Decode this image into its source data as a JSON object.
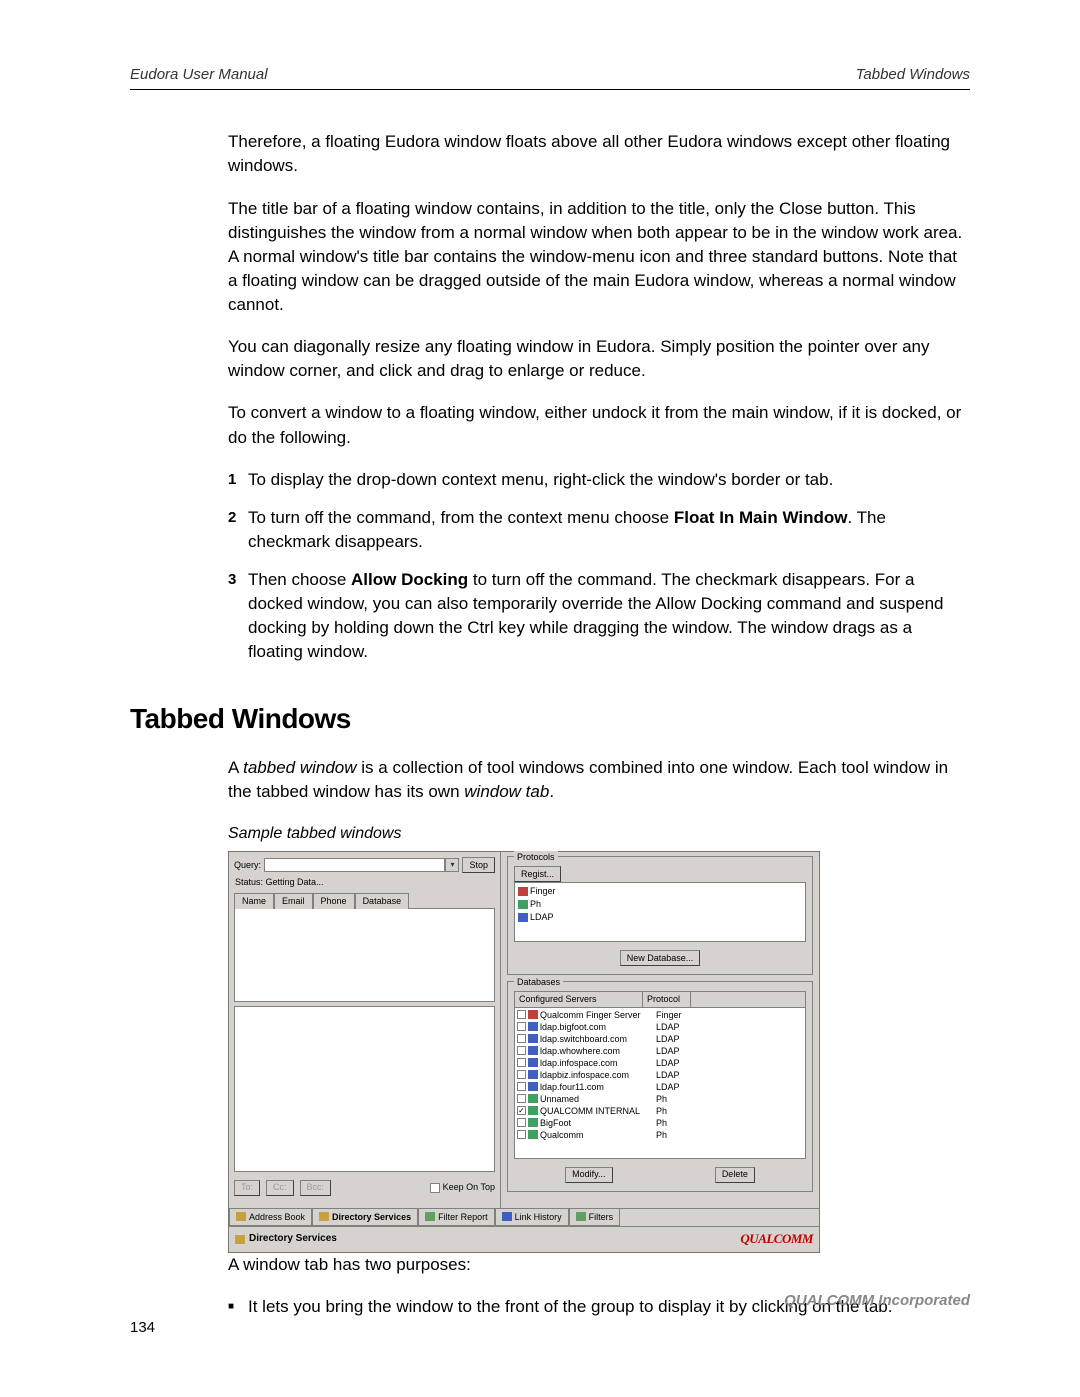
{
  "header": {
    "left": "Eudora User Manual",
    "right": "Tabbed Windows"
  },
  "para1": "Therefore, a floating Eudora window floats above all other Eudora windows except other floating windows.",
  "para2": "The title bar of a floating window contains, in addition to the title, only the Close button. This distinguishes the window from a normal window when both appear to be in the window work area. A normal window's title bar contains the window-menu icon and three standard buttons. Note that a floating window can be dragged outside of the main Eudora window, whereas a normal window cannot.",
  "para3": "You can diagonally resize any floating window in Eudora. Simply position the pointer over any window corner, and click and drag to enlarge or reduce.",
  "para4": "To convert a window to a floating window, either undock it from the main window, if it is docked, or do the following.",
  "steps": [
    {
      "n": "1",
      "pre": "To display the drop-down context menu, right-click the window's border or tab."
    },
    {
      "n": "2",
      "pre": "To turn off the command, from the context menu choose ",
      "bold": "Float In Main Window",
      "post": ". The checkmark disappears."
    },
    {
      "n": "3",
      "pre": "Then choose ",
      "bold": "Allow Docking",
      "post": " to turn off the command. The checkmark disappears. For a docked window, you can also temporarily override the Allow Docking command and suspend docking by holding down the Ctrl key while dragging the window. The window drags as a floating window."
    }
  ],
  "sectionTitle": "Tabbed Windows",
  "sectionIntro": {
    "pre": "A ",
    "em1": "tabbed window",
    "mid": " is a collection of tool windows combined into one window. Each tool window in the tabbed window has its own ",
    "em2": "window tab",
    "post": "."
  },
  "caption": "Sample tabbed windows",
  "fig": {
    "queryLabel": "Query:",
    "stopBtn": "Stop",
    "status": "Status: Getting Data...",
    "headTabs": [
      "Name",
      "Email",
      "Phone",
      "Database"
    ],
    "lbtns": [
      "To:",
      "Cc:",
      "Bcc:"
    ],
    "keepOnTop": "Keep On Top",
    "protocolsLegend": "Protocols",
    "registBtn": "Regist...",
    "protocols": [
      "Finger",
      "Ph",
      "LDAP"
    ],
    "newDbBtn": "New Database...",
    "databasesLegend": "Databases",
    "dbCols": [
      "Configured Servers",
      "Protocol"
    ],
    "dbRows": [
      {
        "chk": false,
        "name": "Qualcomm Finger Server",
        "proto": "Finger"
      },
      {
        "chk": false,
        "name": "ldap.bigfoot.com",
        "proto": "LDAP"
      },
      {
        "chk": false,
        "name": "ldap.switchboard.com",
        "proto": "LDAP"
      },
      {
        "chk": false,
        "name": "ldap.whowhere.com",
        "proto": "LDAP"
      },
      {
        "chk": false,
        "name": "ldap.infospace.com",
        "proto": "LDAP"
      },
      {
        "chk": false,
        "name": "ldapbiz.infospace.com",
        "proto": "LDAP"
      },
      {
        "chk": false,
        "name": "ldap.four11.com",
        "proto": "LDAP"
      },
      {
        "chk": false,
        "name": "Unnamed",
        "proto": "Ph"
      },
      {
        "chk": true,
        "name": "QUALCOMM INTERNAL",
        "proto": "Ph"
      },
      {
        "chk": false,
        "name": "BigFoot",
        "proto": "Ph"
      },
      {
        "chk": false,
        "name": "Qualcomm",
        "proto": "Ph"
      }
    ],
    "modifyBtn": "Modify...",
    "deleteBtn": "Delete",
    "windowTabs": [
      "Address Book",
      "Directory Services",
      "Filter Report",
      "Link History",
      "Filters"
    ],
    "statusbar": "Directory Services",
    "logo": "QUALCOMM"
  },
  "afterFig": "A window tab has two purposes:",
  "bullet1": "It lets you bring the window to the front of the group to display it by clicking on the tab.",
  "footer": {
    "corp": "QUALCOMM Incorporated",
    "page": "134"
  }
}
